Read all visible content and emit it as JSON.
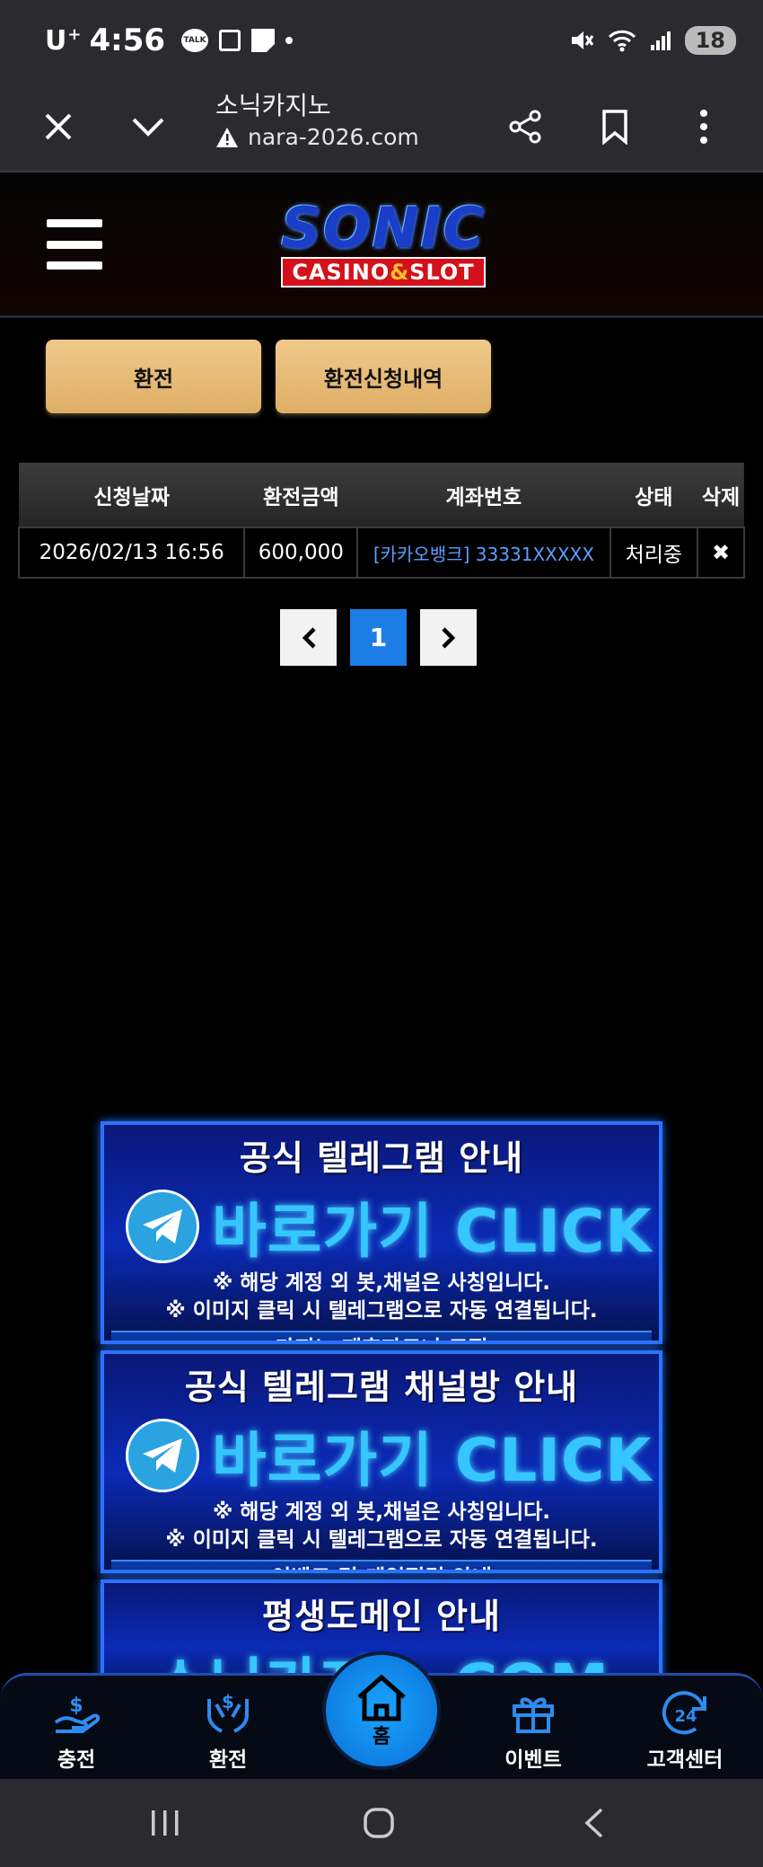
{
  "status_bar": {
    "carrier": "U",
    "carrier_sup": "+",
    "time": "4:56",
    "talk_badge": "TALK",
    "battery": "18"
  },
  "browser": {
    "title": "소닉카지노",
    "url": "nara-2026.com"
  },
  "logo": {
    "top": "SONIC",
    "bottom_left": "CASINO",
    "bottom_amp": "&",
    "bottom_right": "SLOT"
  },
  "buttons": {
    "exchange": "환전",
    "history": "환전신청내역"
  },
  "table": {
    "headers": [
      "신청날짜",
      "환전금액",
      "계좌번호",
      "상태",
      "삭제"
    ],
    "rows": [
      {
        "date": "2026/02/13 16:56",
        "amount": "600,000",
        "account": "[카카오뱅크] 33331XXXXX",
        "status": "처리중",
        "delete": "✖"
      }
    ]
  },
  "pagination": {
    "prev": "‹",
    "current": "1",
    "next": "›"
  },
  "banners": [
    {
      "heading": "공식 텔레그램 안내",
      "click": "바로가기 CLICK",
      "note1": "※ 해당 계정 외 봇,채널은 사칭입니다.",
      "note2": "※ 이미지 클릭 시 텔레그램으로 자동 연결됩니다.",
      "footer": "카지노 제휴파트너 모집"
    },
    {
      "heading": "공식 텔레그램 채널방 안내",
      "click": "바로가기 CLICK",
      "note1": "※ 해당 계정 외 봇,채널은 사칭입니다.",
      "note2": "※ 이미지 클릭 시 텔레그램으로 자동 연결됩니다.",
      "footer": "이벤트 및 게임점검 안내"
    },
    {
      "heading": "평생도메인 안내",
      "domain_partial": "소닉카지노.COM"
    }
  ],
  "bottom_nav": {
    "charge": "충전",
    "exchange": "환전",
    "home": "홈",
    "event": "이벤트",
    "support": "고객센터"
  },
  "colors": {
    "button_gold": "#e8bb76",
    "page_active": "#1c7de6",
    "banner_blue": "#0b2ab6",
    "nav_accent": "#1aa4ff",
    "account_link": "#5c9eff"
  }
}
